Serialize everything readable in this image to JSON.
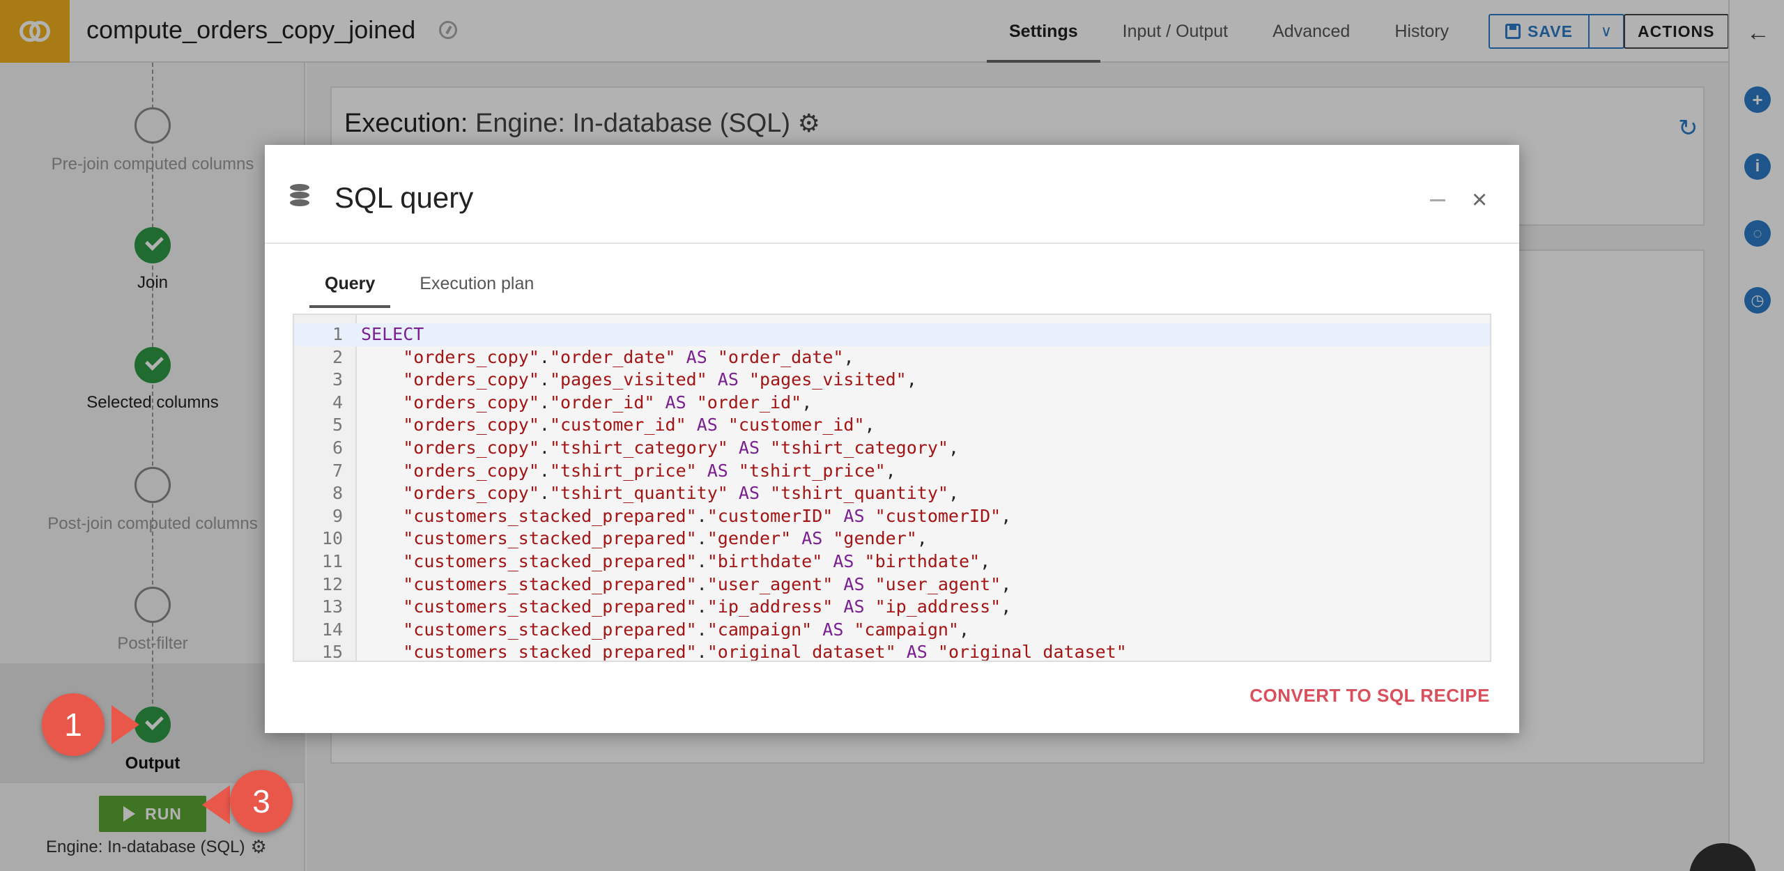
{
  "header": {
    "title": "compute_orders_copy_joined",
    "tabs": [
      {
        "label": "Settings",
        "active": true
      },
      {
        "label": "Input / Output",
        "active": false
      },
      {
        "label": "Advanced",
        "active": false
      },
      {
        "label": "History",
        "active": false
      }
    ],
    "save_label": "SAVE",
    "actions_label": "ACTIONS"
  },
  "steps": [
    {
      "label": "Pre-join computed columns",
      "status": "pending"
    },
    {
      "label": "Join",
      "status": "done"
    },
    {
      "label": "Selected columns",
      "status": "done"
    },
    {
      "label": "Post-join computed columns",
      "status": "pending"
    },
    {
      "label": "Post-filter",
      "status": "pending"
    },
    {
      "label": "Output",
      "status": "done"
    }
  ],
  "run": {
    "label": "RUN",
    "engine_label": "Engine: In-database (SQL)"
  },
  "execution": {
    "prefix": "Execution:",
    "engine": "Engine: In-database (SQL)",
    "behind_text": "_ _ _ , _ _ _ _ _ _ _"
  },
  "modal": {
    "title": "SQL query",
    "tabs": [
      {
        "label": "Query",
        "active": true
      },
      {
        "label": "Execution plan",
        "active": false
      }
    ],
    "convert_label": "CONVERT TO SQL RECIPE",
    "code": [
      {
        "n": "1",
        "kw": "SELECT",
        "a": "",
        "b": "",
        "end": ""
      },
      {
        "n": "2",
        "a": "\"orders_copy\"",
        "b": "\"order_date\"",
        "c": "\"order_date\"",
        "end": ","
      },
      {
        "n": "3",
        "a": "\"orders_copy\"",
        "b": "\"pages_visited\"",
        "c": "\"pages_visited\"",
        "end": ","
      },
      {
        "n": "4",
        "a": "\"orders_copy\"",
        "b": "\"order_id\"",
        "c": "\"order_id\"",
        "end": ","
      },
      {
        "n": "5",
        "a": "\"orders_copy\"",
        "b": "\"customer_id\"",
        "c": "\"customer_id\"",
        "end": ","
      },
      {
        "n": "6",
        "a": "\"orders_copy\"",
        "b": "\"tshirt_category\"",
        "c": "\"tshirt_category\"",
        "end": ","
      },
      {
        "n": "7",
        "a": "\"orders_copy\"",
        "b": "\"tshirt_price\"",
        "c": "\"tshirt_price\"",
        "end": ","
      },
      {
        "n": "8",
        "a": "\"orders_copy\"",
        "b": "\"tshirt_quantity\"",
        "c": "\"tshirt_quantity\"",
        "end": ","
      },
      {
        "n": "9",
        "a": "\"customers_stacked_prepared\"",
        "b": "\"customerID\"",
        "c": "\"customerID\"",
        "end": ","
      },
      {
        "n": "10",
        "a": "\"customers_stacked_prepared\"",
        "b": "\"gender\"",
        "c": "\"gender\"",
        "end": ","
      },
      {
        "n": "11",
        "a": "\"customers_stacked_prepared\"",
        "b": "\"birthdate\"",
        "c": "\"birthdate\"",
        "end": ","
      },
      {
        "n": "12",
        "a": "\"customers_stacked_prepared\"",
        "b": "\"user_agent\"",
        "c": "\"user_agent\"",
        "end": ","
      },
      {
        "n": "13",
        "a": "\"customers_stacked_prepared\"",
        "b": "\"ip_address\"",
        "c": "\"ip_address\"",
        "end": ","
      },
      {
        "n": "14",
        "a": "\"customers_stacked_prepared\"",
        "b": "\"campaign\"",
        "c": "\"campaign\"",
        "end": ","
      },
      {
        "n": "15",
        "a": "\"customers_stacked_prepared\"",
        "b": "\"original_dataset\"",
        "c": "\"original_dataset\"",
        "end": ""
      }
    ],
    "as_keyword": "AS",
    "dot": "."
  },
  "annotations": [
    {
      "label": "1"
    },
    {
      "label": "3"
    }
  ],
  "colors": {
    "accent": "#2b7bc8",
    "success": "#2e9a44",
    "run": "#5ca636",
    "logo": "#f2b01e",
    "annotation": "#e8574a",
    "convert": "#d94f5c"
  }
}
